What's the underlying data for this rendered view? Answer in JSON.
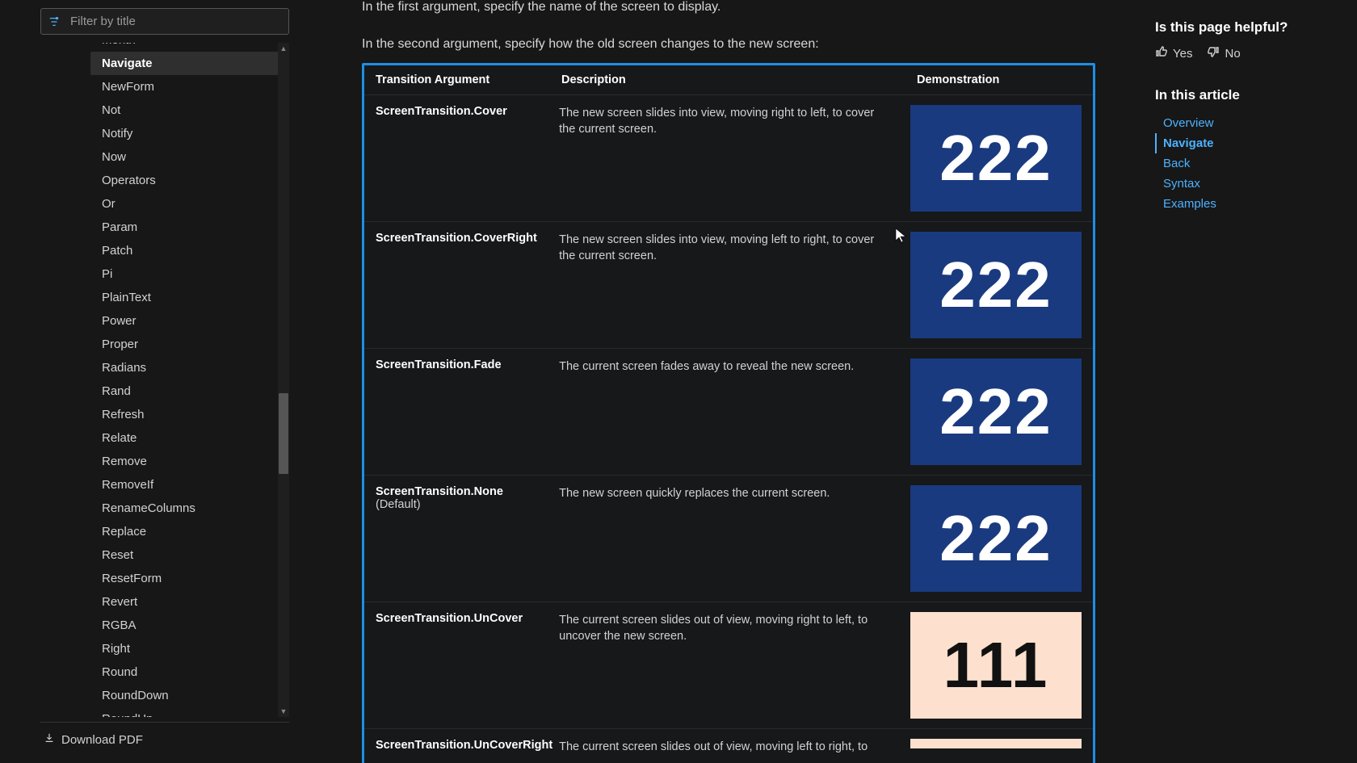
{
  "sidebar": {
    "filter_placeholder": "Filter by title",
    "items": [
      "Month",
      "Navigate",
      "NewForm",
      "Not",
      "Notify",
      "Now",
      "Operators",
      "Or",
      "Param",
      "Patch",
      "Pi",
      "PlainText",
      "Power",
      "Proper",
      "Radians",
      "Rand",
      "Refresh",
      "Relate",
      "Remove",
      "RemoveIf",
      "RenameColumns",
      "Replace",
      "Reset",
      "ResetForm",
      "Revert",
      "RGBA",
      "Right",
      "Round",
      "RoundDown",
      "RoundUp"
    ],
    "active_index": 1,
    "download_label": "Download PDF"
  },
  "content": {
    "intro1": "In the first argument, specify the name of the screen to display.",
    "intro2": "In the second argument, specify how the old screen changes to the new screen:",
    "headers": {
      "arg": "Transition Argument",
      "desc": "Description",
      "demo": "Demonstration"
    },
    "rows": [
      {
        "arg": "ScreenTransition.Cover",
        "sub": "",
        "desc": "The new screen slides into view, moving right to left, to cover the current screen.",
        "demo_text": "222",
        "demo_style": "blue"
      },
      {
        "arg": "ScreenTransition.CoverRight",
        "sub": "",
        "desc": "The new screen slides into view, moving left to right, to cover the current screen.",
        "demo_text": "222",
        "demo_style": "blue"
      },
      {
        "arg": "ScreenTransition.Fade",
        "sub": "",
        "desc": "The current screen fades away to reveal the new screen.",
        "demo_text": "222",
        "demo_style": "blue"
      },
      {
        "arg": "ScreenTransition.None",
        "sub": "(Default)",
        "desc": "The new screen quickly replaces the current screen.",
        "demo_text": "222",
        "demo_style": "blue"
      },
      {
        "arg": "ScreenTransition.UnCover",
        "sub": "",
        "desc": "The current screen slides out of view, moving right to left, to uncover the new screen.",
        "demo_text": "111",
        "demo_style": "peach"
      },
      {
        "arg": "ScreenTransition.UnCoverRight",
        "sub": "",
        "desc": "The current screen slides out of view, moving left to right, to",
        "demo_text": "",
        "demo_style": "peach"
      }
    ]
  },
  "right": {
    "helpful_q": "Is this page helpful?",
    "yes": "Yes",
    "no": "No",
    "in_article": "In this article",
    "toc": [
      "Overview",
      "Navigate",
      "Back",
      "Syntax",
      "Examples"
    ],
    "toc_active_index": 1
  }
}
